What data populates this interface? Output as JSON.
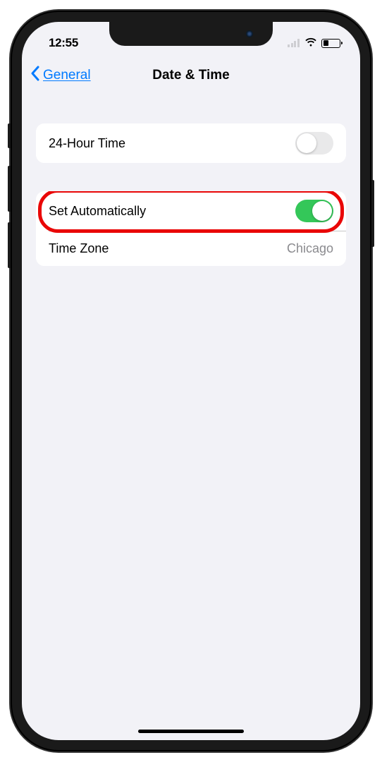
{
  "status_bar": {
    "time": "12:55"
  },
  "nav": {
    "back_label": "General",
    "title": "Date & Time"
  },
  "settings": {
    "group1": {
      "row24h_label": "24-Hour Time",
      "row24h_on": false
    },
    "group2": {
      "set_auto_label": "Set Automatically",
      "set_auto_on": true,
      "timezone_label": "Time Zone",
      "timezone_value": "Chicago"
    }
  }
}
